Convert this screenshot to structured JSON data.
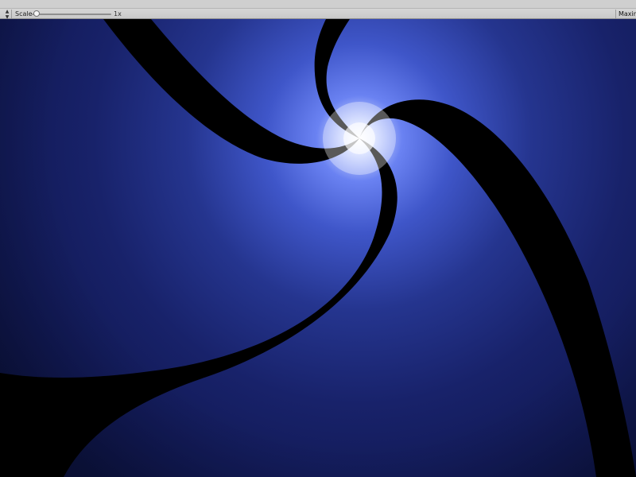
{
  "toolbar": {
    "display_icon": "chevron-updown-icon",
    "scale_label": "Scale",
    "scale_slider_level": 0.02,
    "scale_value": "1x",
    "maximize_label": "Maximize"
  },
  "viewport": {
    "description_icon": "spiral-render",
    "colors": {
      "background": "#131a44",
      "glow_center": "#ffffff",
      "glow_mid": "#5f79ef",
      "arm": "#000000"
    }
  }
}
